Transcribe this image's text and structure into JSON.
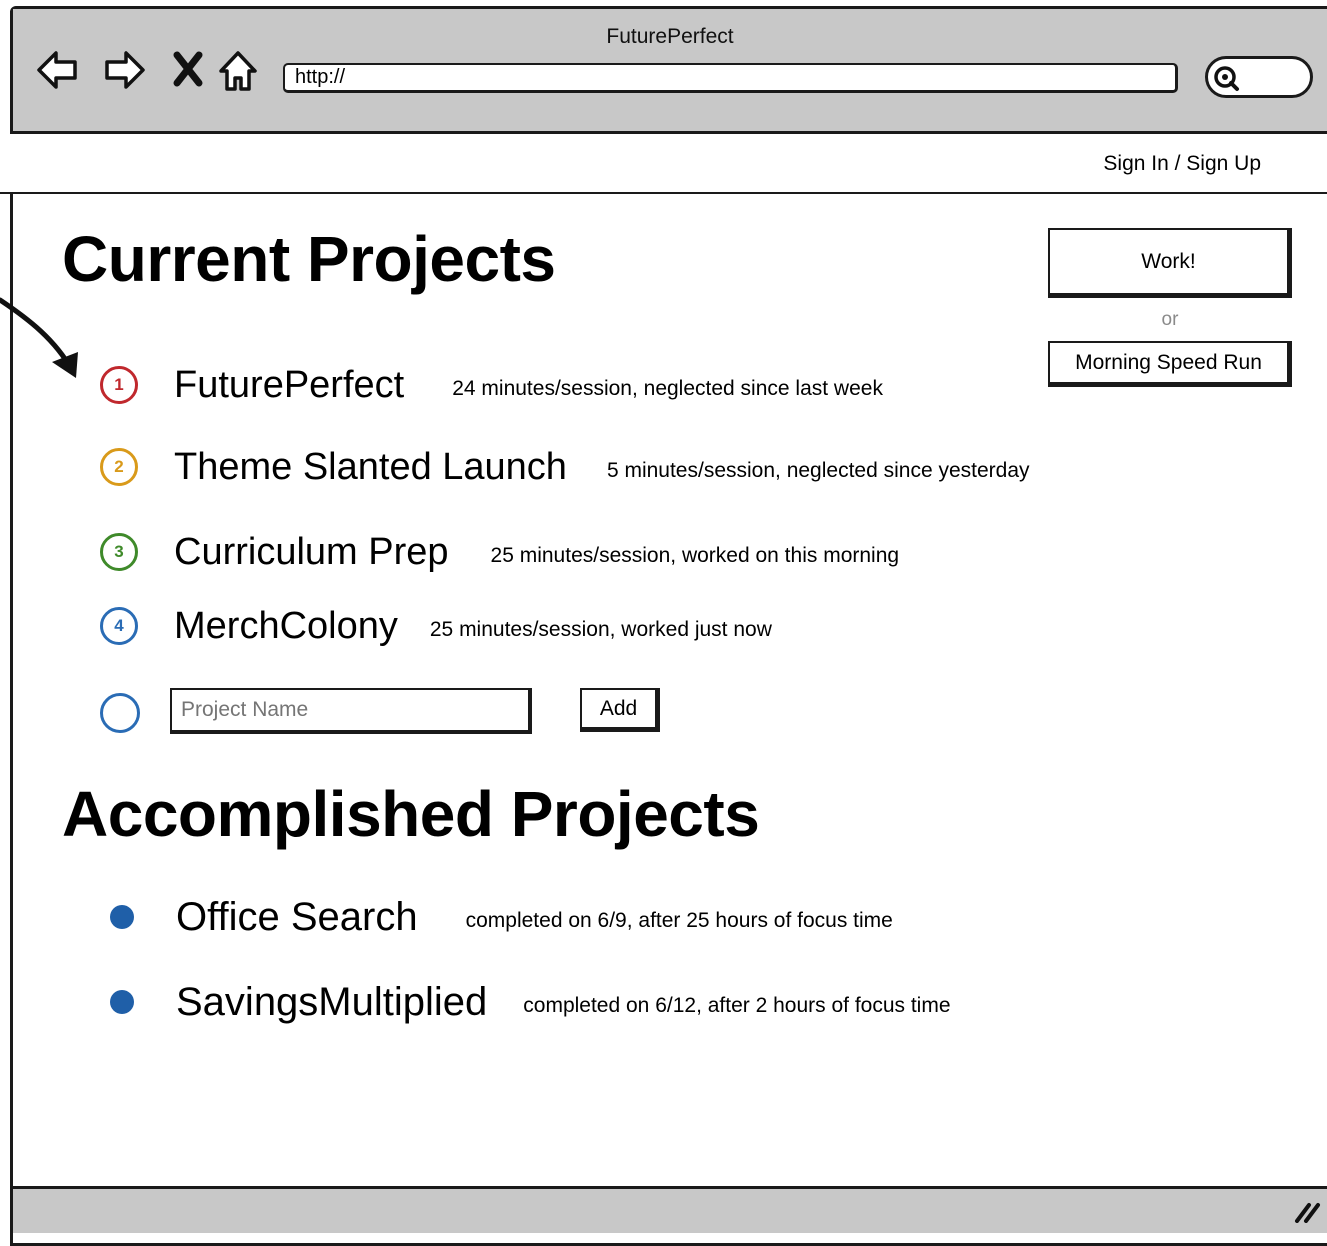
{
  "window": {
    "title": "FuturePerfect"
  },
  "browser": {
    "address": "http://"
  },
  "header": {
    "signin": "Sign In / Sign Up"
  },
  "current": {
    "heading": "Current Projects",
    "projects": [
      {
        "num": "1",
        "color": "#c0282d",
        "name": "FuturePerfect",
        "meta": "24 minutes/session, neglected since last week"
      },
      {
        "num": "2",
        "color": "#d99a1a",
        "name": "Theme Slanted Launch",
        "meta": "5 minutes/session, neglected since yesterday"
      },
      {
        "num": "3",
        "color": "#3f8a2a",
        "name": "Curriculum Prep",
        "meta": "25 minutes/session, worked on this morning"
      },
      {
        "num": "4",
        "color": "#2a6cb5",
        "name": "MerchColony",
        "meta": "25 minutes/session, worked just now"
      }
    ],
    "new_project": {
      "placeholder": "Project Name",
      "add_label": "Add"
    }
  },
  "accomplished": {
    "heading": "Accomplished Projects",
    "projects": [
      {
        "name": "Office Search",
        "meta": "completed on 6/9, after 25 hours of focus time"
      },
      {
        "name": "SavingsMultiplied",
        "meta": "completed on 6/12, after 2 hours of focus time"
      }
    ]
  },
  "actions": {
    "work_label": "Work!",
    "or_label": "or",
    "speed_label": "Morning Speed Run"
  },
  "icons": {
    "back": "back-arrow-icon",
    "forward": "forward-arrow-icon",
    "stop": "stop-x-icon",
    "home": "home-icon",
    "search": "search-icon",
    "resize": "resize-grip-icon"
  }
}
